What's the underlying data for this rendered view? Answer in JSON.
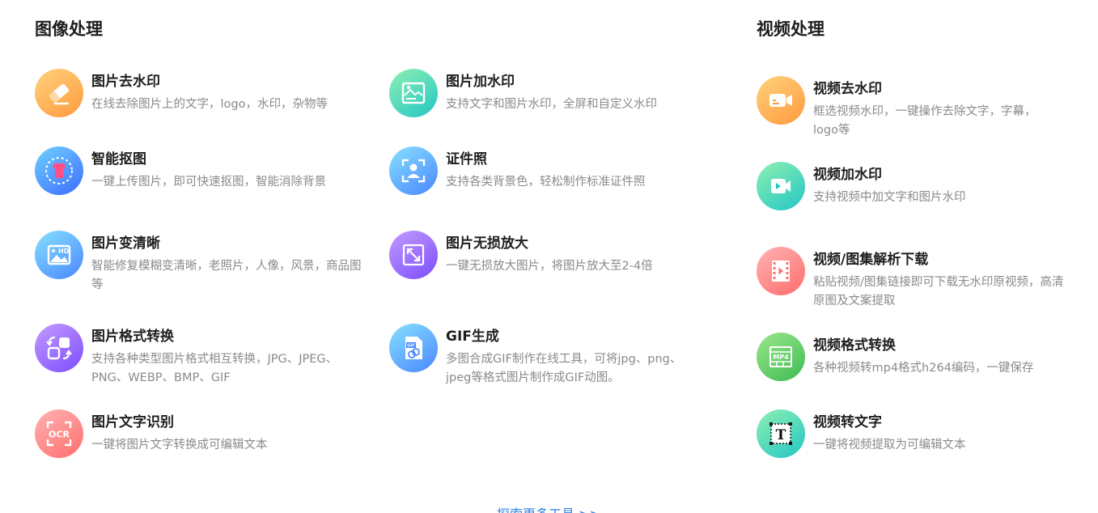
{
  "image_section": {
    "title": "图像处理",
    "tools": [
      {
        "name": "图片去水印",
        "desc": "在线去除图片上的文字，logo，水印，杂物等",
        "icon": "eraser-icon"
      },
      {
        "name": "图片加水印",
        "desc": "支持文字和图片水印，全屏和自定义水印",
        "icon": "image-watermark-icon"
      },
      {
        "name": "智能抠图",
        "desc": "一键上传图片，即可快速抠图，智能消除背景",
        "icon": "cutout-shirt-icon"
      },
      {
        "name": "证件照",
        "desc": "支持各类背景色，轻松制作标准证件照",
        "icon": "id-photo-icon"
      },
      {
        "name": "图片变清晰",
        "desc": "智能修复模糊变清晰，老照片，人像，风景，商品图等",
        "icon": "hd-image-icon"
      },
      {
        "name": "图片无损放大",
        "desc": "一键无损放大图片，将图片放大至2-4倍",
        "icon": "enlarge-icon"
      },
      {
        "name": "图片格式转换",
        "desc": "支持各种类型图片格式相互转换，JPG、JPEG、PNG、WEBP、BMP、GIF",
        "icon": "format-convert-icon"
      },
      {
        "name": "GIF生成",
        "desc": "多图合成GIF制作在线工具，可将jpg、png、jpeg等格式图片制作成GIF动图。",
        "icon": "gif-file-icon"
      },
      {
        "name": "图片文字识别",
        "desc": "一键将图片文字转换成可编辑文本",
        "icon": "ocr-icon",
        "icon_text": "OCR"
      }
    ]
  },
  "video_section": {
    "title": "视频处理",
    "tools": [
      {
        "name": "视频去水印",
        "desc": "框选视频水印，一键操作去除文字，字幕，logo等",
        "icon": "video-camera-icon"
      },
      {
        "name": "视频加水印",
        "desc": "支持视频中加文字和图片水印",
        "icon": "video-play-icon"
      },
      {
        "name": "视频/图集解析下载",
        "desc": "粘贴视频/图集链接即可下载无水印原视频，高清原图及文案提取",
        "icon": "film-strip-icon"
      },
      {
        "name": "视频格式转换",
        "desc": "各种视频转mp4格式h264编码，一键保存",
        "icon": "mp4-icon",
        "icon_text": "MP4"
      },
      {
        "name": "视频转文字",
        "desc": "一键将视频提取为可编辑文本",
        "icon": "text-extract-icon",
        "icon_text": "T"
      }
    ]
  },
  "more_link": "探索更多工具 >>"
}
